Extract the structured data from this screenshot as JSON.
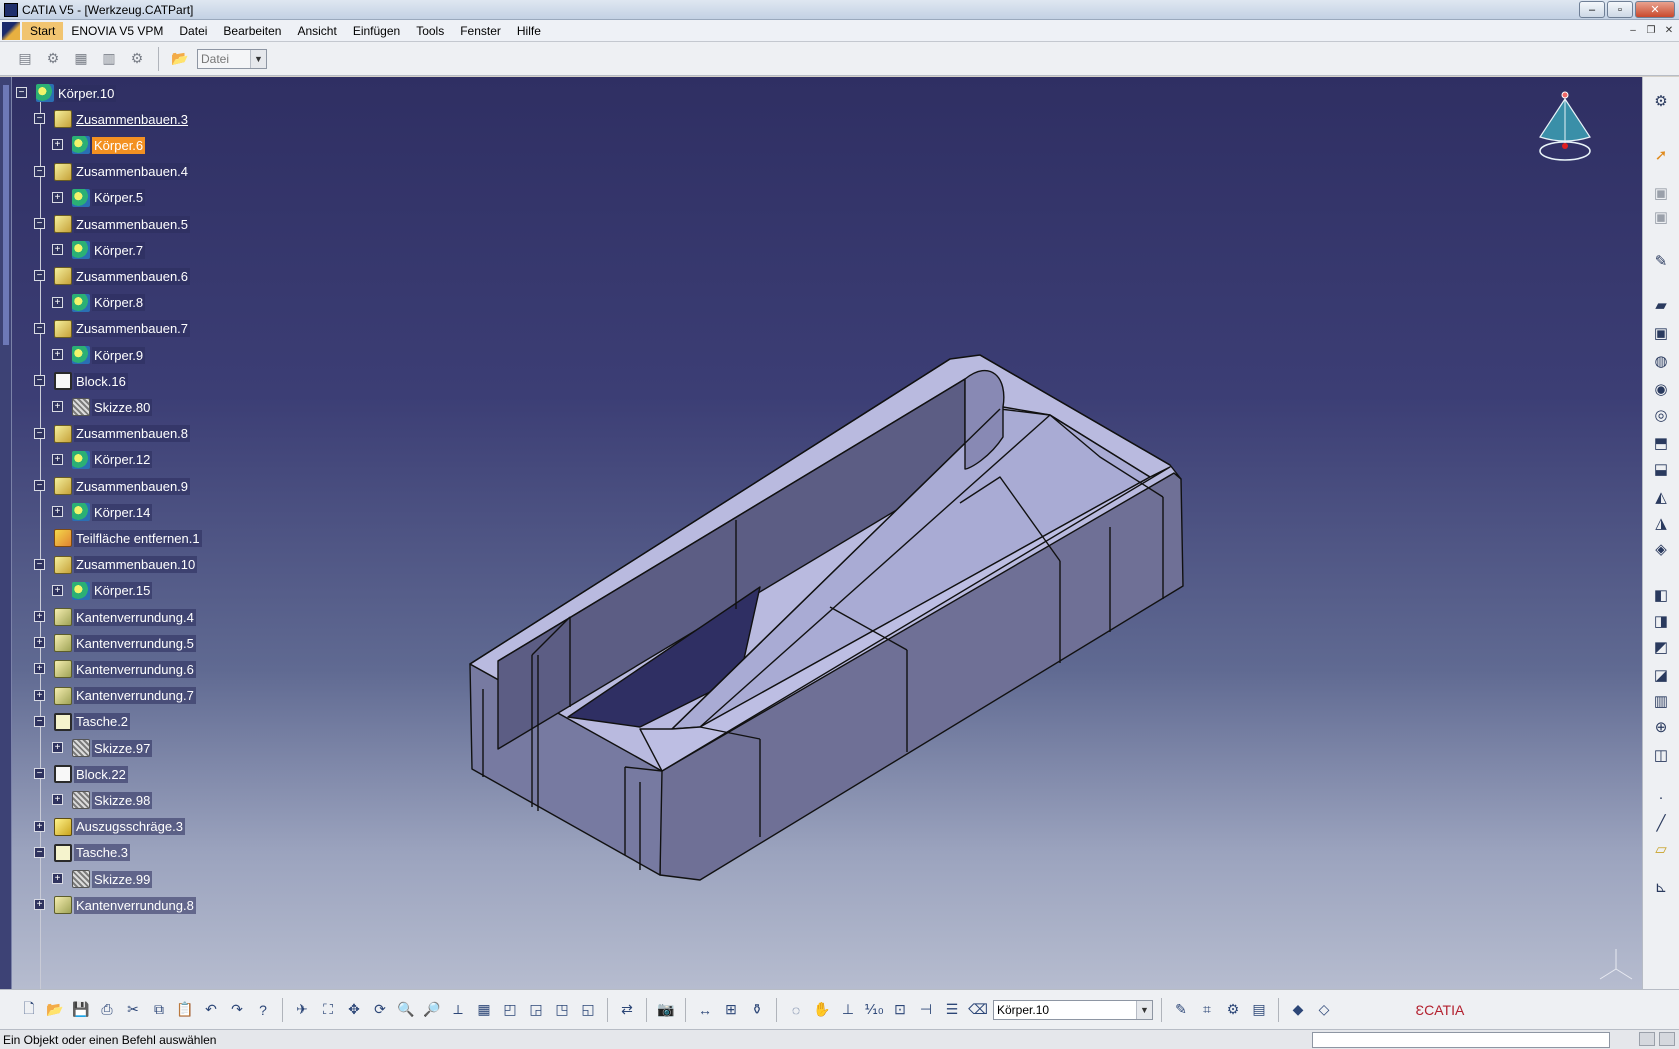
{
  "window": {
    "title": "CATIA V5 - [Werkzeug.CATPart]",
    "buttons": [
      "–",
      "▫",
      "✕"
    ]
  },
  "menu": {
    "items": [
      "Start",
      "ENOVIA V5 VPM",
      "Datei",
      "Bearbeiten",
      "Ansicht",
      "Einfügen",
      "Tools",
      "Fenster",
      "Hilfe"
    ],
    "active_index": 0
  },
  "top_toolbar": {
    "file_combo_value": "Datei"
  },
  "tree": {
    "nodes": [
      {
        "label": "Körper.10",
        "icon": "body-icon",
        "level": 0,
        "expander": "−"
      },
      {
        "label": "Zusammenbauen.3",
        "icon": "union-icon",
        "level": 1,
        "expander": "−",
        "underline": true
      },
      {
        "label": "Körper.6",
        "icon": "body-icon",
        "level": 2,
        "expander": "+",
        "selected": true
      },
      {
        "label": "Zusammenbauen.4",
        "icon": "union-icon",
        "level": 1,
        "expander": "−"
      },
      {
        "label": "Körper.5",
        "icon": "body-icon",
        "level": 2,
        "expander": "+"
      },
      {
        "label": "Zusammenbauen.5",
        "icon": "union-icon",
        "level": 1,
        "expander": "−"
      },
      {
        "label": "Körper.7",
        "icon": "body-icon",
        "level": 2,
        "expander": "+"
      },
      {
        "label": "Zusammenbauen.6",
        "icon": "union-icon",
        "level": 1,
        "expander": "−"
      },
      {
        "label": "Körper.8",
        "icon": "body-icon",
        "level": 2,
        "expander": "+"
      },
      {
        "label": "Zusammenbauen.7",
        "icon": "union-icon",
        "level": 1,
        "expander": "−"
      },
      {
        "label": "Körper.9",
        "icon": "body-icon",
        "level": 2,
        "expander": "+"
      },
      {
        "label": "Block.16",
        "icon": "pad-icon",
        "level": 1,
        "expander": "−"
      },
      {
        "label": "Skizze.80",
        "icon": "sketch-icon",
        "level": 2,
        "expander": "+"
      },
      {
        "label": "Zusammenbauen.8",
        "icon": "union-icon",
        "level": 1,
        "expander": "−"
      },
      {
        "label": "Körper.12",
        "icon": "body-icon",
        "level": 2,
        "expander": "+"
      },
      {
        "label": "Zusammenbauen.9",
        "icon": "union-icon",
        "level": 1,
        "expander": "−"
      },
      {
        "label": "Körper.14",
        "icon": "body-icon",
        "level": 2,
        "expander": "+"
      },
      {
        "label": "Teilfläche entfernen.1",
        "icon": "remove-face-icon",
        "level": 1,
        "expander": ""
      },
      {
        "label": "Zusammenbauen.10",
        "icon": "union-icon",
        "level": 1,
        "expander": "−"
      },
      {
        "label": "Körper.15",
        "icon": "body-icon",
        "level": 2,
        "expander": "+"
      },
      {
        "label": "Kantenverrundung.4",
        "icon": "fillet-icon",
        "level": 1,
        "expander": "+"
      },
      {
        "label": "Kantenverrundung.5",
        "icon": "fillet-icon",
        "level": 1,
        "expander": "+"
      },
      {
        "label": "Kantenverrundung.6",
        "icon": "fillet-icon",
        "level": 1,
        "expander": "+"
      },
      {
        "label": "Kantenverrundung.7",
        "icon": "fillet-icon",
        "level": 1,
        "expander": "+"
      },
      {
        "label": "Tasche.2",
        "icon": "pocket-icon",
        "level": 1,
        "expander": "−"
      },
      {
        "label": "Skizze.97",
        "icon": "sketch-icon",
        "level": 2,
        "expander": "+"
      },
      {
        "label": "Block.22",
        "icon": "pad-icon",
        "level": 1,
        "expander": "−"
      },
      {
        "label": "Skizze.98",
        "icon": "sketch-icon",
        "level": 2,
        "expander": "+"
      },
      {
        "label": "Auszugsschräge.3",
        "icon": "draft-icon",
        "level": 1,
        "expander": "+"
      },
      {
        "label": "Tasche.3",
        "icon": "pocket-icon",
        "level": 1,
        "expander": "−"
      },
      {
        "label": "Skizze.99",
        "icon": "sketch-icon",
        "level": 2,
        "expander": "+"
      },
      {
        "label": "Kantenverrundung.8",
        "icon": "fillet-icon",
        "level": 1,
        "expander": "+"
      }
    ]
  },
  "bottom_toolbar": {
    "body_combo_value": "Körper.10"
  },
  "status": {
    "message": "Ein Objekt oder einen Befehl auswählen"
  },
  "colors": {
    "selection": "#f39122",
    "model_face": "#b9badf",
    "background_top": "#2f2f63",
    "background_bottom": "#b6bccf"
  }
}
